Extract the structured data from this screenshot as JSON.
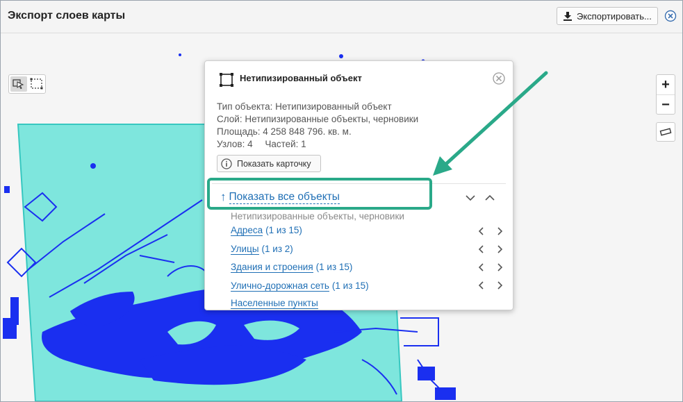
{
  "window": {
    "title": "Экспорт слоев карты",
    "export_label": "Экспортировать...",
    "close_icon": "close-circle-icon"
  },
  "colors": {
    "highlight": "#2aa989",
    "link": "#1f6fb5",
    "selection_fill": "#7ee6dd",
    "map_features": "#1a2ff0"
  },
  "popup": {
    "title": "Нетипизированный объект",
    "type_line": "Тип объекта: Нетипизированный объект",
    "layer_line": "Слой: Нетипизированные объекты, черновики",
    "area_line": "Площадь: 4 258 848 796. кв. м.",
    "nodes": "Узлов: 4",
    "parts": "Частей: 1",
    "card_button": "Показать карточку",
    "show_all": "Показать все объекты",
    "layer_name": "Нетипизированные объекты, черновики",
    "layers": [
      {
        "name": "Адреса",
        "count": "(1 из 15)"
      },
      {
        "name": "Улицы",
        "count": "(1 из 2)"
      },
      {
        "name": "Здания и строения",
        "count": "(1 из 15)"
      },
      {
        "name": "Улично-дорожная сеть",
        "count": "(1 из 15)"
      },
      {
        "name": "Населенные пункты",
        "count": ""
      }
    ]
  },
  "map_controls": {
    "zoom_in": "+",
    "zoom_out": "−"
  }
}
